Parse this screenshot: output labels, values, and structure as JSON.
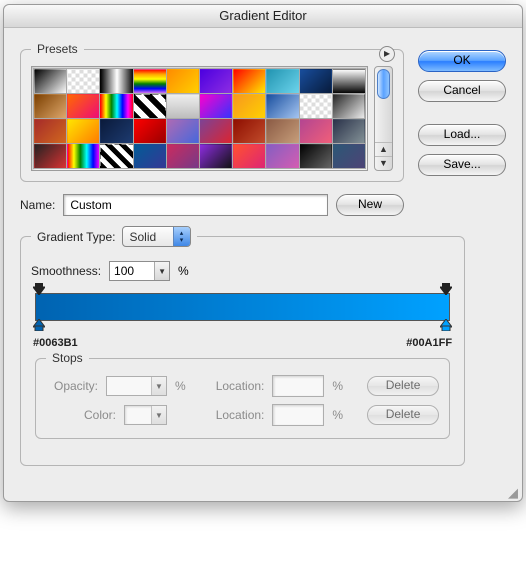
{
  "window": {
    "title": "Gradient Editor"
  },
  "buttons": {
    "ok": "OK",
    "cancel": "Cancel",
    "load": "Load...",
    "save": "Save...",
    "new": "New",
    "delete": "Delete"
  },
  "presets": {
    "legend": "Presets",
    "rows": [
      [
        "linear-gradient(135deg,#000,#fff)",
        "repeating-conic-gradient(#ddd 0 25%,#fff 0 50%) 0 0/8px 8px",
        "linear-gradient(90deg,#000,#fff,#000)",
        "linear-gradient(red,orange,yellow,green,blue,violet)",
        "linear-gradient(135deg,#ff8a00,#ffd000)",
        "linear-gradient(135deg,#4a00e0,#8e2de2)",
        "linear-gradient(135deg,#ff0000,#ffee00)",
        "linear-gradient(135deg,#2193b0,#6dd5ed)",
        "linear-gradient(135deg,#184e9e,#071a3a)",
        "linear-gradient(#fff,#000)"
      ],
      [
        "linear-gradient(135deg,#7b3f00,#e0a96d)",
        "linear-gradient(135deg,#ff6a00,#ee0979)",
        "linear-gradient(90deg,red,yellow,green,cyan,blue,magenta,red)",
        "repeating-linear-gradient(45deg,#000 0 6px,#fff 6px 12px)",
        "linear-gradient(#efefef,#bcbcbc)",
        "linear-gradient(135deg,#ff00cc,#3333ff)",
        "linear-gradient(135deg,#f7971e,#ffd200)",
        "linear-gradient(135deg,#184e9e,#a7c7f2)",
        "repeating-conic-gradient(#ddd 0 25%,#fff 0 50%) 0 0/8px 8px",
        "linear-gradient(135deg,#222,#eee)"
      ],
      [
        "linear-gradient(135deg,#a52a2a,#d2691e)",
        "linear-gradient(135deg,#ffe600,#ff7a00)",
        "linear-gradient(135deg,#0a1a3a,#1e3c72)",
        "linear-gradient(135deg,#ff0000,#990000)",
        "linear-gradient(135deg,#b06ab3,#4568dc)",
        "linear-gradient(135deg,#7b4397,#dc2430)",
        "linear-gradient(135deg,#8e0e00,#c24d2c)",
        "linear-gradient(135deg,#8a5a44,#c89f7b)",
        "linear-gradient(135deg,#b24592,#f15f79)",
        "linear-gradient(135deg,#283048,#859398)"
      ],
      [
        "linear-gradient(135deg,#222,#dd3333)",
        "linear-gradient(90deg,red,yellow,green,cyan,blue,magenta)",
        "repeating-linear-gradient(45deg,#000 0 5px,#fff 5px 10px)",
        "linear-gradient(135deg,#005c97,#363795)",
        "linear-gradient(135deg,#cc2b5e,#753a88)",
        "linear-gradient(135deg,#8e2de2,#111)",
        "linear-gradient(135deg,#ff512f,#dd2476)",
        "linear-gradient(135deg,#845ec2,#d65db1)",
        "linear-gradient(135deg,#000,#666)",
        "linear-gradient(135deg,#2b5876,#4e4376)"
      ]
    ]
  },
  "name": {
    "label": "Name:",
    "value": "Custom"
  },
  "gradient_type": {
    "label": "Gradient Type:",
    "value": "Solid"
  },
  "smoothness": {
    "label": "Smoothness:",
    "value": "100",
    "unit": "%"
  },
  "gradient": {
    "left_color": "#0063B1",
    "right_color": "#00A1FF",
    "left_label": "#0063B1",
    "right_label": "#00A1FF"
  },
  "stops": {
    "legend": "Stops",
    "opacity_label": "Opacity:",
    "color_label": "Color:",
    "location_label": "Location:",
    "pct": "%",
    "opacity_value": "",
    "color_value": "",
    "location1_value": "",
    "location2_value": ""
  }
}
